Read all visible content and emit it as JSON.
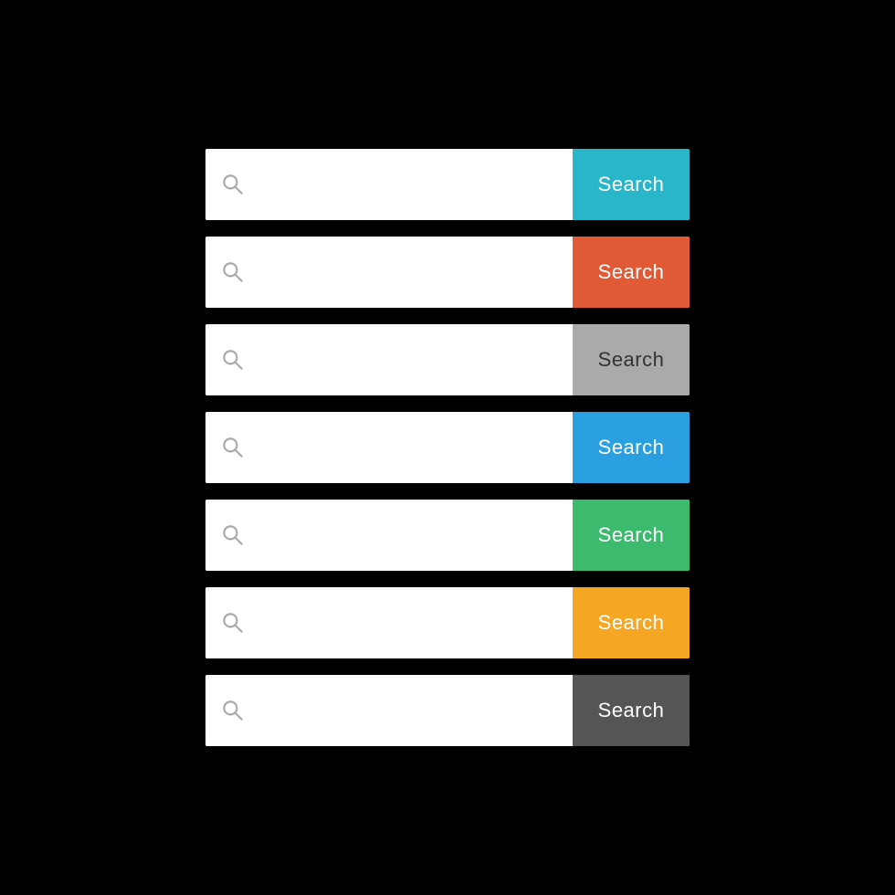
{
  "searchBars": [
    {
      "id": "bar-1",
      "buttonLabel": "Search",
      "buttonClass": "btn-cyan",
      "inputPlaceholder": ""
    },
    {
      "id": "bar-2",
      "buttonLabel": "Search",
      "buttonClass": "btn-orange",
      "inputPlaceholder": ""
    },
    {
      "id": "bar-3",
      "buttonLabel": "Search",
      "buttonClass": "btn-gray",
      "inputPlaceholder": ""
    },
    {
      "id": "bar-4",
      "buttonLabel": "Search",
      "buttonClass": "btn-blue",
      "inputPlaceholder": ""
    },
    {
      "id": "bar-5",
      "buttonLabel": "Search",
      "buttonClass": "btn-green",
      "inputPlaceholder": ""
    },
    {
      "id": "bar-6",
      "buttonLabel": "Search",
      "buttonClass": "btn-amber",
      "inputPlaceholder": ""
    },
    {
      "id": "bar-7",
      "buttonLabel": "Search",
      "buttonClass": "btn-darkgray",
      "inputPlaceholder": ""
    }
  ]
}
